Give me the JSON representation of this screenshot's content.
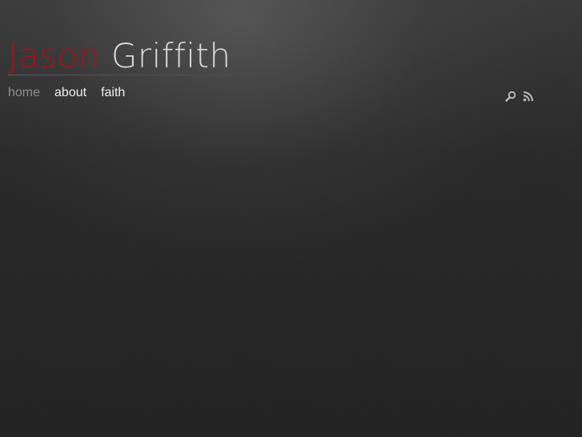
{
  "header": {
    "logo_first": "Jason",
    "logo_last": "Griffith"
  },
  "nav": {
    "items": [
      {
        "label": "home",
        "active": true
      },
      {
        "label": "about",
        "active": false
      },
      {
        "label": "faith",
        "active": false
      }
    ]
  },
  "tools": {
    "search_icon": "search-icon",
    "rss_icon": "rss-icon"
  },
  "colors": {
    "accent": "#a3141a",
    "logo_text": "#dadada",
    "nav_text": "#f0f0f0",
    "nav_active": "#8f8f8f",
    "background": "#2a2a2a"
  }
}
